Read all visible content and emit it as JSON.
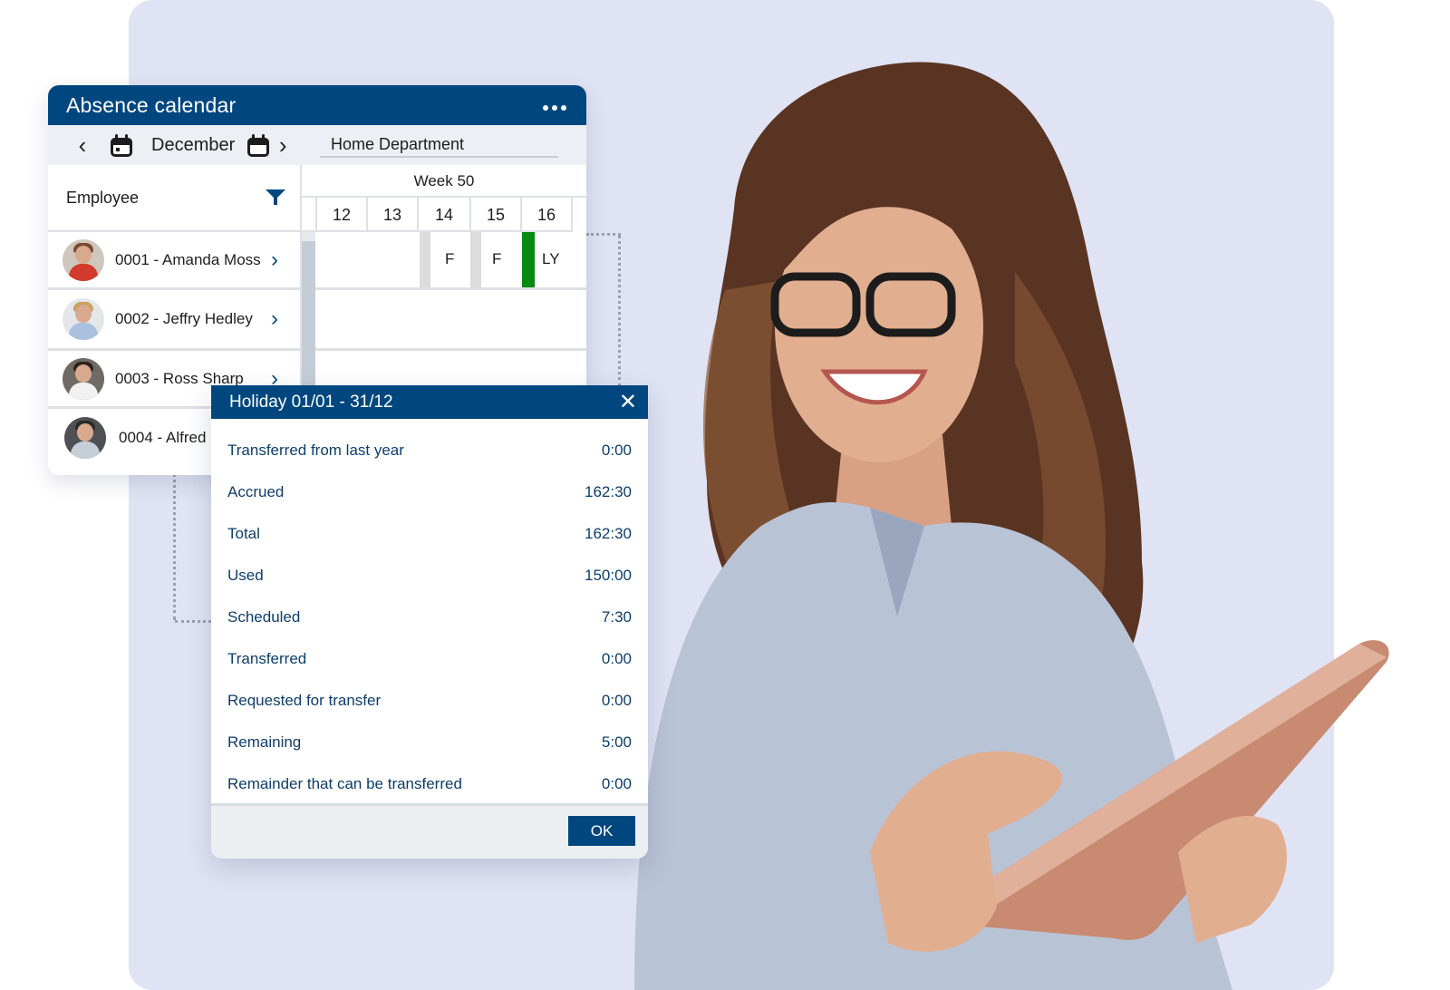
{
  "calendar": {
    "title": "Absence calendar",
    "more_icon": "more-horizontal-icon",
    "toolbar": {
      "prev_icon": "chevron-left-icon",
      "prev_calendar_icon": "calendar-icon",
      "month": "December",
      "next_calendar_icon": "calendar-icon",
      "next_icon": "chevron-right-icon",
      "department": "Home Department"
    },
    "employee_column": {
      "header": "Employee",
      "filter_icon": "filter-icon"
    },
    "week_label": "Week 50",
    "days": [
      "12",
      "13",
      "14",
      "15",
      "16"
    ],
    "employees": [
      {
        "label": "0001 - Amanda Moss",
        "cells": {
          "14": "F",
          "15": "F",
          "16": "LY"
        }
      },
      {
        "label": "0002 - Jeffry Hedley"
      },
      {
        "label": "0003 - Ross Sharp"
      },
      {
        "label": "0004 - Alfred"
      }
    ],
    "colors": {
      "header": "#01477f",
      "approved_marker": "#078a12",
      "weekend_marker": "#dcdcdc"
    }
  },
  "dialog": {
    "title": "Holiday 01/01 - 31/12",
    "close_icon": "close-icon",
    "rows": [
      {
        "label": "Transferred from last year",
        "value": "0:00"
      },
      {
        "label": "Accrued",
        "value": "162:30"
      },
      {
        "label": "Total",
        "value": "162:30"
      },
      {
        "label": "Used",
        "value": "150:00"
      },
      {
        "label": "Scheduled",
        "value": "7:30"
      },
      {
        "label": "Transferred",
        "value": "0:00"
      },
      {
        "label": "Requested for transfer",
        "value": "0:00"
      },
      {
        "label": "Remaining",
        "value": "5:00"
      },
      {
        "label": "Remainder that can be transferred",
        "value": "0:00"
      }
    ],
    "ok_label": "OK"
  },
  "illustration": {
    "subject": "smiling woman with glasses holding a tablet"
  }
}
